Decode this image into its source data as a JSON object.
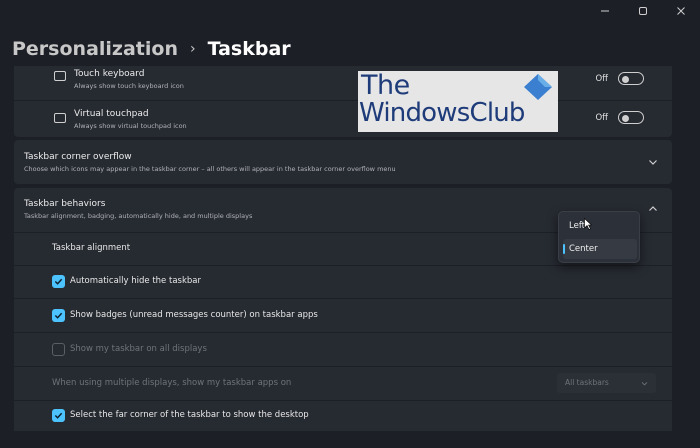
{
  "breadcrumb": {
    "parent": "Personalization",
    "separator": "›",
    "current": "Taskbar"
  },
  "window_controls": [
    "minimize-icon",
    "maximize-icon",
    "close-icon"
  ],
  "corner_icons": [
    {
      "title": "Touch keyboard",
      "subtitle": "Always show touch keyboard icon",
      "state": "Off",
      "on": false,
      "icon": "keyboard-icon"
    },
    {
      "title": "Virtual touchpad",
      "subtitle": "Always show virtual touchpad icon",
      "state": "Off",
      "on": false,
      "icon": "touchpad-icon"
    }
  ],
  "overflow": {
    "title": "Taskbar corner overflow",
    "subtitle": "Choose which icons may appear in the taskbar corner – all others will appear in the taskbar corner overflow menu",
    "expanded": false
  },
  "behaviors": {
    "title": "Taskbar behaviors",
    "subtitle": "Taskbar alignment, badging, automatically hide, and multiple displays",
    "expanded": true,
    "alignment_label": "Taskbar alignment",
    "alignment_options": [
      "Left",
      "Center"
    ],
    "alignment_selected": "Center",
    "auto_hide": {
      "label": "Automatically hide the taskbar",
      "checked": true,
      "enabled": true
    },
    "badges": {
      "label": "Show badges (unread messages counter) on taskbar apps",
      "checked": true,
      "enabled": true
    },
    "all_displays": {
      "label": "Show my taskbar on all displays",
      "checked": false,
      "enabled": false
    },
    "multi_display": {
      "label": "When using multiple displays, show my taskbar apps on",
      "value": "All taskbars",
      "enabled": false
    },
    "far_corner": {
      "label": "Select the far corner of the taskbar to show the desktop",
      "checked": true,
      "enabled": true
    }
  },
  "watermark": {
    "line1": "The",
    "line2": "WindowsClub"
  },
  "colors": {
    "accent": "#4cc2ff",
    "background": "#1c1f26",
    "card": "#262a31"
  }
}
